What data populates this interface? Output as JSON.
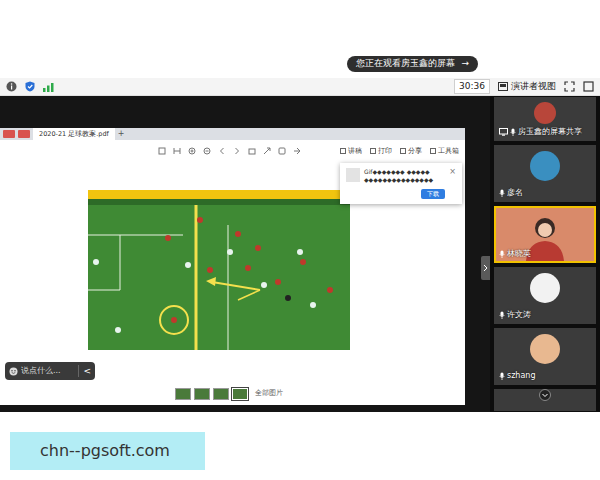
{
  "banner": {
    "text": "您正在观看房玉鑫的屏幕",
    "arrow": "→"
  },
  "meeting_bar": {
    "timer": "30:36",
    "view_button": "演讲者视图"
  },
  "shared_screen": {
    "tabs": [
      {
        "label": "2020-21 足球教案.pdf",
        "selected": true
      }
    ],
    "new_tab": "+",
    "tools": [
      "讲稿",
      "打印",
      "分享",
      "工具箱"
    ],
    "popup": {
      "lines": [
        "Gif◆◆◆◆◆◆◆ ◆◆◆◆◆",
        "◆◆◆◆◆◆◆◆◆◆◆◆◆◆◆"
      ],
      "button": "下载",
      "close": "×"
    },
    "thumbnails": [
      {
        "selected": false
      },
      {
        "selected": false
      },
      {
        "selected": false
      },
      {
        "selected": true
      }
    ],
    "thumbnails_label": "全部图片"
  },
  "chat": {
    "placeholder": "说点什么...",
    "toggle": "<"
  },
  "participants": [
    {
      "name": "房玉鑫的屏幕共享",
      "kind": "avatar",
      "color": "#b8463a",
      "sharing": true,
      "speaking": false
    },
    {
      "name": "彦名",
      "kind": "avatar",
      "color": "#3a8fc0",
      "sharing": false,
      "speaking": false
    },
    {
      "name": "林晓英",
      "kind": "video",
      "color": "#d98a6a",
      "sharing": false,
      "speaking": true
    },
    {
      "name": "许文涛",
      "kind": "avatar",
      "color": "#f2f2f2",
      "sharing": false,
      "speaking": false
    },
    {
      "name": "szhang",
      "kind": "avatar",
      "color": "#e8b890",
      "sharing": false,
      "speaking": false
    }
  ],
  "watermark": "chn--pgsoft.com"
}
